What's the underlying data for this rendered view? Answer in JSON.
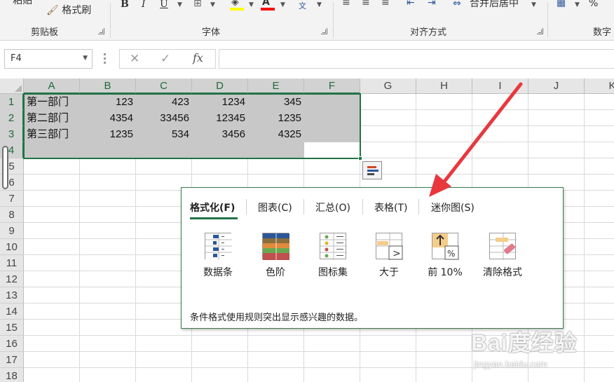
{
  "ribbon": {
    "paste_partial": "粘贴",
    "format_painter": "格式刷",
    "groups": [
      "剪贴板",
      "字体",
      "对齐方式",
      "数字"
    ],
    "bold": "B",
    "italic": "I",
    "underline": "U",
    "phonetic": "文",
    "merge_center": "合并后居中",
    "percent": "%"
  },
  "formula_bar": {
    "name_box": "F4",
    "cancel": "✕",
    "enter": "✓",
    "fx": "fx",
    "content": ""
  },
  "sheet": {
    "columns": [
      "A",
      "B",
      "C",
      "D",
      "E",
      "F",
      "G",
      "H",
      "I",
      "J",
      "K"
    ],
    "rows": [
      "1",
      "2",
      "3",
      "4",
      "5",
      "6",
      "7",
      "8",
      "9",
      "10",
      "11",
      "12",
      "13",
      "14",
      "15",
      "16",
      "17",
      "18"
    ],
    "data": [
      [
        "第一部门",
        "123",
        "423",
        "1234",
        "345"
      ],
      [
        "第二部门",
        "4354",
        "33456",
        "12345",
        "1235"
      ],
      [
        "第三部门",
        "1235",
        "534",
        "3456",
        "4325"
      ]
    ]
  },
  "quick_analysis": {
    "tabs": [
      "格式化(F)",
      "图表(C)",
      "汇总(O)",
      "表格(T)",
      "迷你图(S)"
    ],
    "active_tab": 0,
    "items": [
      {
        "label": "数据条",
        "icon": "data-bars-icon"
      },
      {
        "label": "色阶",
        "icon": "color-scale-icon"
      },
      {
        "label": "图标集",
        "icon": "icon-set-icon"
      },
      {
        "label": "大于",
        "icon": "greater-than-icon"
      },
      {
        "label": "前 10%",
        "icon": "top-10-percent-icon"
      },
      {
        "label": "清除格式",
        "icon": "clear-format-icon"
      }
    ],
    "description": "条件格式使用规则突出显示感兴趣的数据。"
  },
  "watermark": {
    "logo": "Bai度经验",
    "url": "jingyan.baidu.com"
  },
  "colors": {
    "accent": "#217346",
    "selection": "#c8c8c8",
    "arrow": "#e8383d"
  }
}
